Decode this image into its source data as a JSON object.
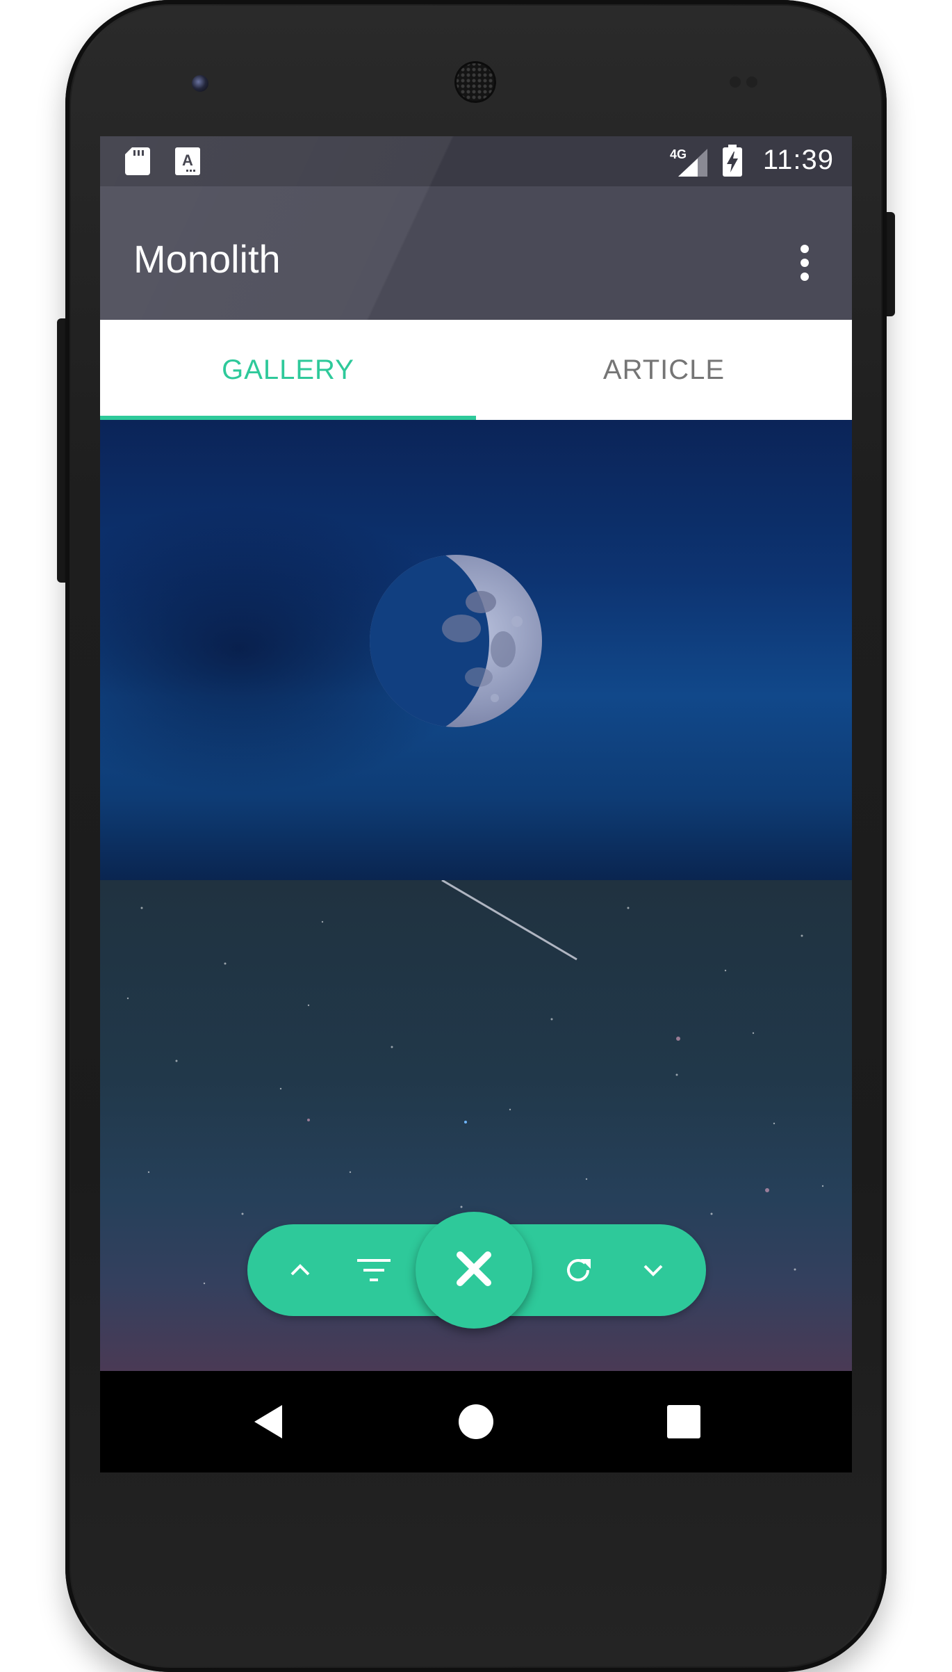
{
  "status_bar": {
    "time": "11:39",
    "network": "4G",
    "icons": [
      "sd-card-icon",
      "app-notification-icon",
      "signal-icon",
      "battery-charging-icon"
    ]
  },
  "app_bar": {
    "title": "Monolith",
    "menu_icon": "more-vert-icon"
  },
  "tabs": [
    {
      "label": "GALLERY",
      "selected": true
    },
    {
      "label": "ARTICLE",
      "selected": false
    }
  ],
  "gallery": {
    "images": [
      "moon-photo",
      "shooting-star-photo"
    ]
  },
  "action_bar": {
    "items": [
      "chevron-up-icon",
      "filter-icon",
      "close-icon",
      "refresh-icon",
      "chevron-down-icon"
    ]
  },
  "nav_bar": {
    "items": [
      "back-icon",
      "home-icon",
      "recents-icon"
    ]
  },
  "colors": {
    "accent": "#2ec99a",
    "status_bar": "#3a3a45",
    "app_bar": "#4a4a57",
    "tab_inactive": "#757575"
  }
}
